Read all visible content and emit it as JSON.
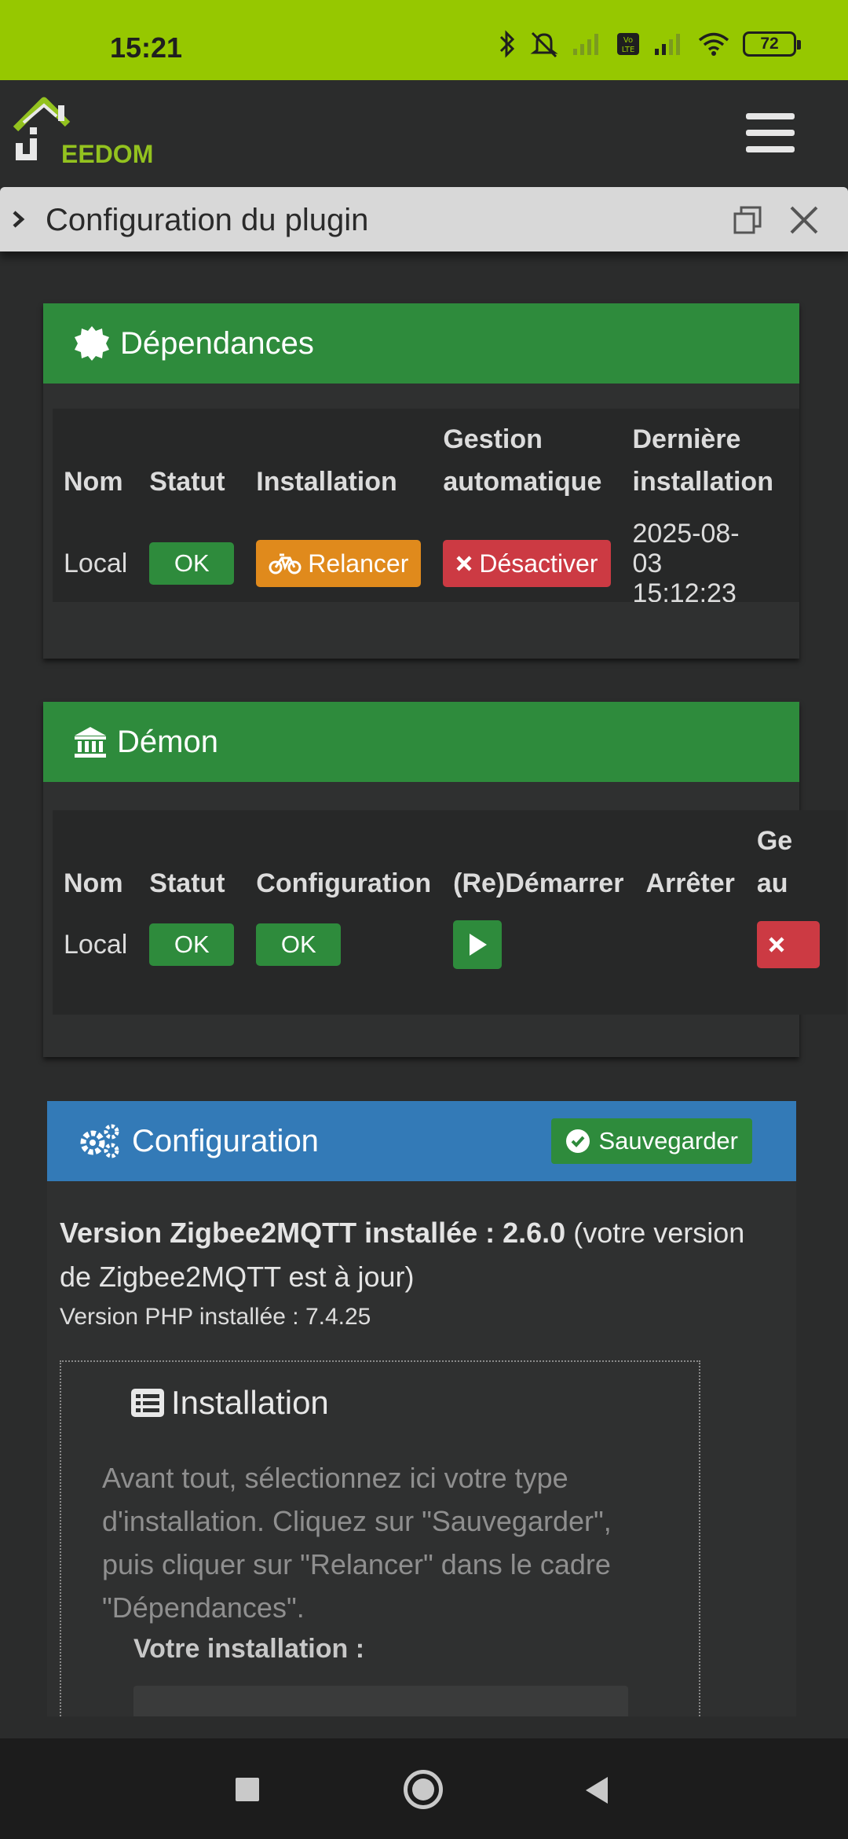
{
  "status_bar": {
    "time": "15:21",
    "battery": "72"
  },
  "header": {
    "logo_text": "EEDOM"
  },
  "modal": {
    "title": "Configuration du plugin"
  },
  "colors": {
    "success": "#2e8b3c",
    "warning": "#e08a1c",
    "danger": "#cc3a43",
    "primary": "#337ab7",
    "statusbar": "#96c800"
  },
  "dependances": {
    "title": "Dépendances",
    "headers": {
      "nom": "Nom",
      "statut": "Statut",
      "installation": "Installation",
      "gestion_1": "Gestion",
      "gestion_2": "automatique",
      "derniere_1": "Dernière",
      "derniere_2": "installation"
    },
    "row": {
      "nom": "Local",
      "statut": "OK",
      "relancer": "Relancer",
      "desactiver": "Désactiver",
      "date_1": "2025-08-",
      "date_2": "03",
      "date_3": "15:12:23"
    }
  },
  "demon": {
    "title": "Démon",
    "headers": {
      "nom": "Nom",
      "statut": "Statut",
      "configuration": "Configuration",
      "redemarrer": "(Re)Démarrer",
      "arreter": "Arrêter",
      "gestion_1": "Ge",
      "gestion_2": "au"
    },
    "row": {
      "nom": "Local",
      "statut": "OK",
      "configuration": "OK"
    }
  },
  "configuration": {
    "title": "Configuration",
    "save_label": "Sauvegarder",
    "version_bold": "Version Zigbee2MQTT installée : 2.6.0",
    "version_rest": " (votre version de Zigbee2MQTT est à jour)",
    "php_version": "Version PHP installée : 7.4.25",
    "installation_legend": "Installation",
    "installation_help": "Avant tout, sélectionnez ici votre type d'installation. Cliquez sur \"Sauvegarder\", puis cliquer sur \"Relancer\" dans le cadre \"Dépendances\".",
    "installation_label": "Votre installation :"
  }
}
